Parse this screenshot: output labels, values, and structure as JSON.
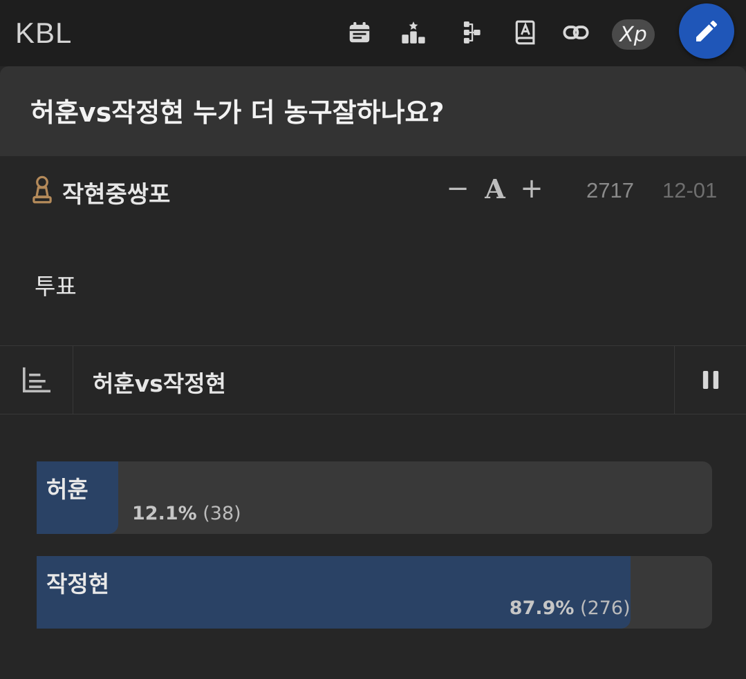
{
  "topbar": {
    "brand": "KBL",
    "icons": [
      "calendar-icon",
      "ranking-podium-icon",
      "sitemap-icon",
      "dictionary-icon",
      "link-icon",
      "xp-icon",
      "pencil-icon"
    ],
    "xp_label": "Xp",
    "write_button_color": "#1f56b8"
  },
  "post": {
    "title": "허훈vs작정현 누가 더 농구잘하나요?",
    "author": "작현중쌍포",
    "author_icon": "pawn-icon",
    "font_controls": {
      "decrease": "−",
      "font": "A",
      "increase": "+"
    },
    "views": "2717",
    "date": "12-01",
    "body": "투표"
  },
  "poll": {
    "title": "허훈vs작정현",
    "fill_color": "#2a4265",
    "options": [
      {
        "label": "허훈",
        "percent": 12.1,
        "percent_text": "12.1%",
        "count_text": "(38)"
      },
      {
        "label": "작정현",
        "percent": 87.9,
        "percent_text": "87.9%",
        "count_text": "(276)"
      }
    ]
  }
}
